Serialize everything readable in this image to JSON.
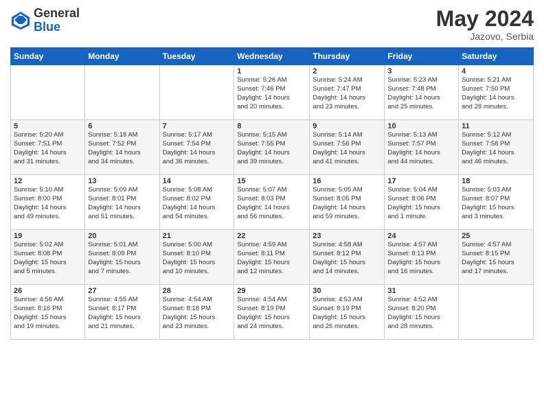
{
  "header": {
    "logo_line1": "General",
    "logo_line2": "Blue",
    "month_year": "May 2024",
    "location": "Jazovo, Serbia"
  },
  "days_of_week": [
    "Sunday",
    "Monday",
    "Tuesday",
    "Wednesday",
    "Thursday",
    "Friday",
    "Saturday"
  ],
  "weeks": [
    [
      {
        "num": "",
        "info": ""
      },
      {
        "num": "",
        "info": ""
      },
      {
        "num": "",
        "info": ""
      },
      {
        "num": "1",
        "info": "Sunrise: 5:26 AM\nSunset: 7:46 PM\nDaylight: 14 hours\nand 20 minutes."
      },
      {
        "num": "2",
        "info": "Sunrise: 5:24 AM\nSunset: 7:47 PM\nDaylight: 14 hours\nand 23 minutes."
      },
      {
        "num": "3",
        "info": "Sunrise: 5:23 AM\nSunset: 7:48 PM\nDaylight: 14 hours\nand 25 minutes."
      },
      {
        "num": "4",
        "info": "Sunrise: 5:21 AM\nSunset: 7:50 PM\nDaylight: 14 hours\nand 28 minutes."
      }
    ],
    [
      {
        "num": "5",
        "info": "Sunrise: 5:20 AM\nSunset: 7:51 PM\nDaylight: 14 hours\nand 31 minutes."
      },
      {
        "num": "6",
        "info": "Sunrise: 5:18 AM\nSunset: 7:52 PM\nDaylight: 14 hours\nand 34 minutes."
      },
      {
        "num": "7",
        "info": "Sunrise: 5:17 AM\nSunset: 7:54 PM\nDaylight: 14 hours\nand 36 minutes."
      },
      {
        "num": "8",
        "info": "Sunrise: 5:15 AM\nSunset: 7:55 PM\nDaylight: 14 hours\nand 39 minutes."
      },
      {
        "num": "9",
        "info": "Sunrise: 5:14 AM\nSunset: 7:56 PM\nDaylight: 14 hours\nand 41 minutes."
      },
      {
        "num": "10",
        "info": "Sunrise: 5:13 AM\nSunset: 7:57 PM\nDaylight: 14 hours\nand 44 minutes."
      },
      {
        "num": "11",
        "info": "Sunrise: 5:12 AM\nSunset: 7:58 PM\nDaylight: 14 hours\nand 46 minutes."
      }
    ],
    [
      {
        "num": "12",
        "info": "Sunrise: 5:10 AM\nSunset: 8:00 PM\nDaylight: 14 hours\nand 49 minutes."
      },
      {
        "num": "13",
        "info": "Sunrise: 5:09 AM\nSunset: 8:01 PM\nDaylight: 14 hours\nand 51 minutes."
      },
      {
        "num": "14",
        "info": "Sunrise: 5:08 AM\nSunset: 8:02 PM\nDaylight: 14 hours\nand 54 minutes."
      },
      {
        "num": "15",
        "info": "Sunrise: 5:07 AM\nSunset: 8:03 PM\nDaylight: 14 hours\nand 56 minutes."
      },
      {
        "num": "16",
        "info": "Sunrise: 5:05 AM\nSunset: 8:05 PM\nDaylight: 14 hours\nand 59 minutes."
      },
      {
        "num": "17",
        "info": "Sunrise: 5:04 AM\nSunset: 8:06 PM\nDaylight: 15 hours\nand 1 minute."
      },
      {
        "num": "18",
        "info": "Sunrise: 5:03 AM\nSunset: 8:07 PM\nDaylight: 15 hours\nand 3 minutes."
      }
    ],
    [
      {
        "num": "19",
        "info": "Sunrise: 5:02 AM\nSunset: 8:08 PM\nDaylight: 15 hours\nand 5 minutes."
      },
      {
        "num": "20",
        "info": "Sunrise: 5:01 AM\nSunset: 8:09 PM\nDaylight: 15 hours\nand 7 minutes."
      },
      {
        "num": "21",
        "info": "Sunrise: 5:00 AM\nSunset: 8:10 PM\nDaylight: 15 hours\nand 10 minutes."
      },
      {
        "num": "22",
        "info": "Sunrise: 4:59 AM\nSunset: 8:11 PM\nDaylight: 15 hours\nand 12 minutes."
      },
      {
        "num": "23",
        "info": "Sunrise: 4:58 AM\nSunset: 8:12 PM\nDaylight: 15 hours\nand 14 minutes."
      },
      {
        "num": "24",
        "info": "Sunrise: 4:57 AM\nSunset: 8:13 PM\nDaylight: 15 hours\nand 16 minutes."
      },
      {
        "num": "25",
        "info": "Sunrise: 4:57 AM\nSunset: 8:15 PM\nDaylight: 15 hours\nand 17 minutes."
      }
    ],
    [
      {
        "num": "26",
        "info": "Sunrise: 4:56 AM\nSunset: 8:16 PM\nDaylight: 15 hours\nand 19 minutes."
      },
      {
        "num": "27",
        "info": "Sunrise: 4:55 AM\nSunset: 8:17 PM\nDaylight: 15 hours\nand 21 minutes."
      },
      {
        "num": "28",
        "info": "Sunrise: 4:54 AM\nSunset: 8:18 PM\nDaylight: 15 hours\nand 23 minutes."
      },
      {
        "num": "29",
        "info": "Sunrise: 4:54 AM\nSunset: 8:19 PM\nDaylight: 15 hours\nand 24 minutes."
      },
      {
        "num": "30",
        "info": "Sunrise: 4:53 AM\nSunset: 8:19 PM\nDaylight: 15 hours\nand 26 minutes."
      },
      {
        "num": "31",
        "info": "Sunrise: 4:52 AM\nSunset: 8:20 PM\nDaylight: 15 hours\nand 28 minutes."
      },
      {
        "num": "",
        "info": ""
      }
    ]
  ]
}
